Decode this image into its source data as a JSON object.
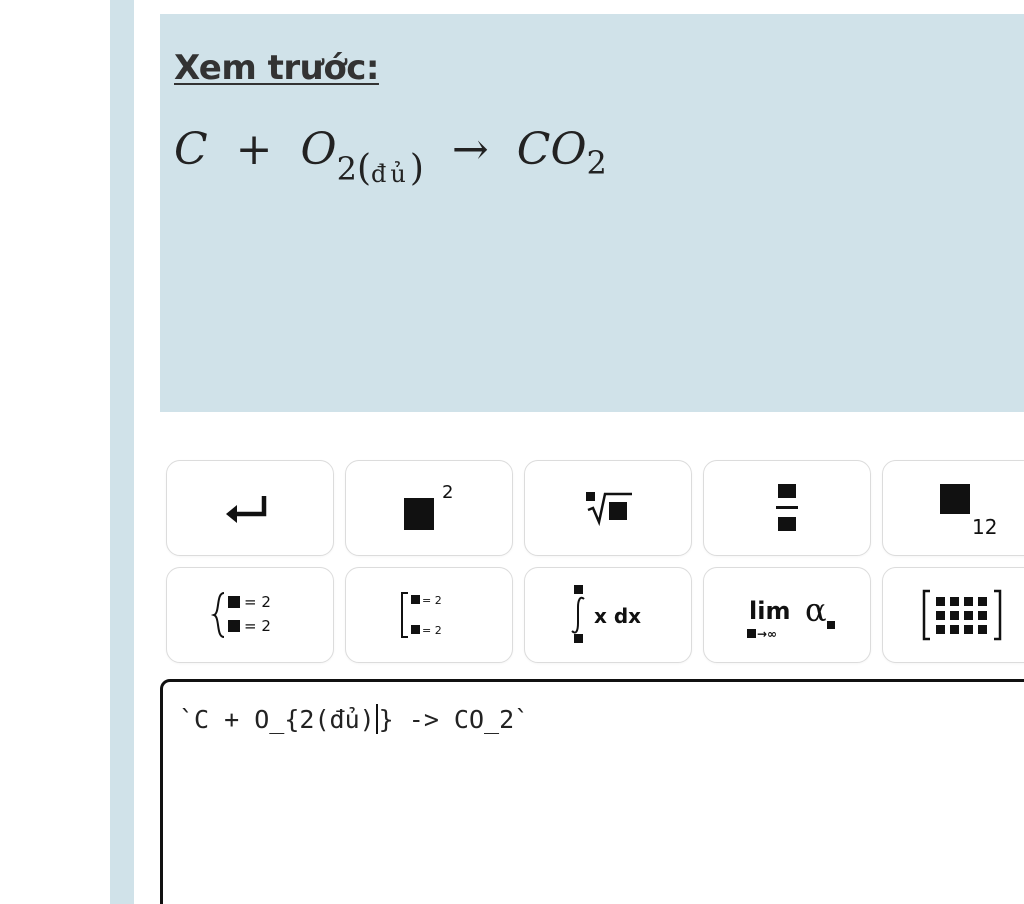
{
  "preview": {
    "heading": "Xem trước:",
    "formula": {
      "c": "C",
      "plus": "+",
      "o": "O",
      "o_sub": "2",
      "note_open": "(",
      "note": "đủ",
      "note_close": ")",
      "arrow": "→",
      "co": "CO",
      "co_sub": "2"
    }
  },
  "toolbar": {
    "row1": [
      {
        "icon": "enter-icon"
      },
      {
        "icon": "superscript-icon",
        "label": "2"
      },
      {
        "icon": "nth-root-icon"
      },
      {
        "icon": "fraction-icon"
      },
      {
        "icon": "subscript-icon",
        "label": "12"
      }
    ],
    "row2": [
      {
        "icon": "equation-system-icon",
        "label": "= 2"
      },
      {
        "icon": "bracket-system-icon",
        "label": "= 2"
      },
      {
        "icon": "integral-icon",
        "label": "x dx"
      },
      {
        "icon": "limit-icon",
        "label": "lim",
        "symbol": "α"
      },
      {
        "icon": "matrix-icon"
      }
    ]
  },
  "editor": {
    "text_before_caret": "`C + O_{2(đủ)",
    "text_after_caret": "} -> CO_2`"
  }
}
